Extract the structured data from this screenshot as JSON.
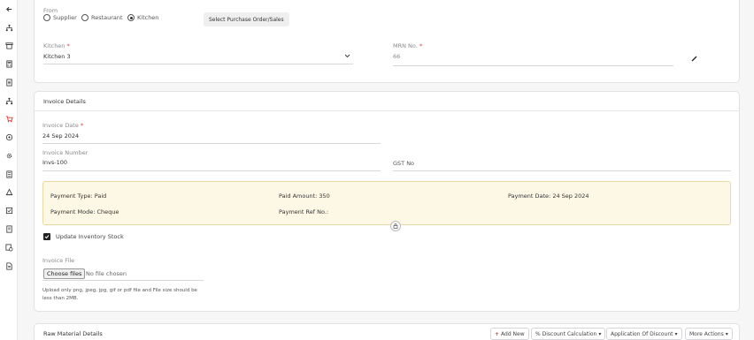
{
  "source": {
    "label": "From",
    "options": [
      "Supplier",
      "Restaurant",
      "Kitchen"
    ],
    "selected": "Kitchen",
    "select_button": "Select Purchase Order/Sales"
  },
  "kitchen": {
    "label": "Kitchen",
    "required_mark": "*",
    "value": "Kitchen 3"
  },
  "mrn": {
    "label": "MRN No.",
    "required_mark": "*",
    "value": "66"
  },
  "invoice": {
    "title": "Invoice Details",
    "date_label": "Invoice Date",
    "date_required": "*",
    "date_value": "24 Sep 2024",
    "number_label": "Invoice Number",
    "number_value": "Invs-100",
    "gst_placeholder": "GST No"
  },
  "payment": {
    "type": "Payment Type: Paid",
    "amount": "Paid Amount: 350",
    "date": "Payment Date: 24 Sep 2024",
    "mode": "Payment Mode: Cheque",
    "ref": "Payment Ref No.:"
  },
  "stock": {
    "label": "Update Inventory Stock",
    "checked": true
  },
  "file": {
    "label": "Invoice File",
    "button": "Choose files",
    "status": "No file chosen",
    "hint": "Upload only png, jpeg, jpg, gif or pdf file and File size should be less than 2MB."
  },
  "raw_material": {
    "title": "Raw Material Details",
    "add_new": "Add New",
    "discount_calc": "% Discount Calculation",
    "application_discount": "Application Of Discount",
    "more_actions": "More Actions"
  },
  "colors": {
    "accent": "#e53935",
    "payment_bg": "#fdf8e6",
    "payment_border": "#e9d9a5"
  },
  "sidebar_icons": [
    "back-arrow-icon",
    "org-chart-icon",
    "box-icon",
    "calculator-icon",
    "document-icon",
    "hierarchy-icon",
    "cart-icon",
    "settings-icon",
    "gear-icon",
    "list-icon",
    "user-icon",
    "checklist-icon",
    "report-icon",
    "report-check-icon",
    "file-icon"
  ]
}
